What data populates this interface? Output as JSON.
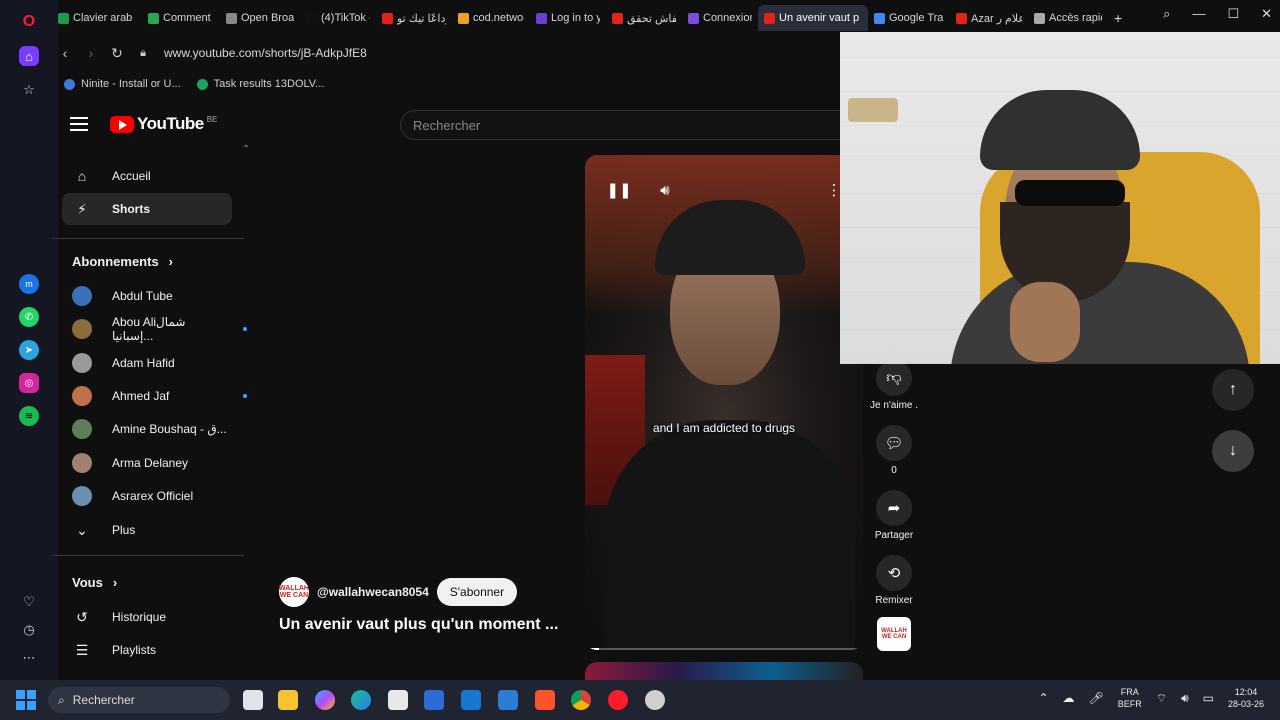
{
  "browser": {
    "tabs": [
      {
        "label": "Clavier arab",
        "color": "#1e9a4c"
      },
      {
        "label": "Comment cl",
        "color": "#2da44e"
      },
      {
        "label": "Open Broad",
        "color": "#888888"
      },
      {
        "label": "(4)TikTok -",
        "color": "#111111"
      },
      {
        "label": "وداعًا تيك تو",
        "color": "#e62117"
      },
      {
        "label": "cod.network",
        "color": "#f0a020"
      },
      {
        "label": "Log in to yo",
        "color": "#6a3fd1"
      },
      {
        "label": "كيفاش تحقق",
        "color": "#e62117"
      },
      {
        "label": "Connexion",
        "color": "#7b4dd8"
      },
      {
        "label": "Un avenir vaut p",
        "color": "#e62117"
      },
      {
        "label": "Google Trar",
        "color": "#4285f4"
      },
      {
        "label": "Azar علام ر",
        "color": "#e62117"
      },
      {
        "label": "Accès rapid",
        "color": "#aaaaaa"
      }
    ],
    "active_tab_index": 9,
    "url": "www.youtube.com/shorts/jB-AdkpJfE8",
    "bookmarks": [
      {
        "label": "Ninite - Install or U...",
        "color": "#3a7bd5"
      },
      {
        "label": "Task results 13DOLV...",
        "color": "#1aa260"
      }
    ]
  },
  "youtube": {
    "logo_text": "YouTube",
    "region": "BE",
    "search_placeholder": "Rechercher",
    "nav": {
      "home": "Accueil",
      "shorts": "Shorts"
    },
    "subscriptions_heading": "Abonnements",
    "subscriptions": [
      {
        "name": "Abdul Tube",
        "color": "#3b6fb6",
        "live": false
      },
      {
        "name": "Abou Aliشمال إسبانيا...",
        "color": "#8a6d3b",
        "live": true
      },
      {
        "name": "Adam Hafid",
        "color": "#999999",
        "live": false
      },
      {
        "name": "Ahmed Jaf",
        "color": "#c0704a",
        "live": true
      },
      {
        "name": "Amine Boushaq - ق...",
        "color": "#5f7d5a",
        "live": false
      },
      {
        "name": "Arma Delaney",
        "color": "#a08070",
        "live": false
      },
      {
        "name": "Asrarex Officiel",
        "color": "#6a8fb0",
        "live": false
      }
    ],
    "more_label": "Plus",
    "you_heading": "Vous",
    "you_items": {
      "history": "Historique",
      "playlists": "Playlists"
    },
    "short": {
      "caption": "and I am addicted to drugs",
      "channel": "@wallahwecan8054",
      "subscribe": "S'abonner",
      "title": "Un avenir vaut plus qu'un moment ...",
      "channel_badge": "WALLAH WE CAN",
      "progress": 0.05
    },
    "actions": {
      "dislike": "Je n'aime .",
      "comments": "0",
      "share": "Partager",
      "remix": "Remixer"
    }
  },
  "taskbar": {
    "search_placeholder": "Rechercher",
    "lang_line1": "FRA",
    "lang_line2": "BEFR",
    "time": "12:04",
    "date": "28-03-26"
  }
}
